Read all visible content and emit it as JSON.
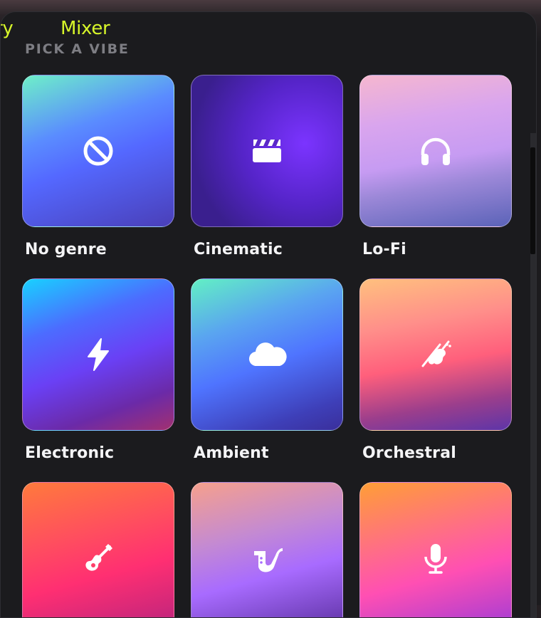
{
  "tabs": {
    "partial_label": "ry",
    "mixer_label": "Mixer"
  },
  "section": {
    "title": "PICK A VIBE"
  },
  "accent_color": "#d7f52a",
  "genres": [
    {
      "label": "No genre",
      "icon": "no-symbol-icon"
    },
    {
      "label": "Cinematic",
      "icon": "clapperboard-icon"
    },
    {
      "label": "Lo-Fi",
      "icon": "headphones-icon"
    },
    {
      "label": "Electronic",
      "icon": "lightning-bolt-icon"
    },
    {
      "label": "Ambient",
      "icon": "cloud-icon"
    },
    {
      "label": "Orchestral",
      "icon": "violin-icon"
    },
    {
      "label": "",
      "icon": "guitar-icon"
    },
    {
      "label": "",
      "icon": "saxophone-icon"
    },
    {
      "label": "",
      "icon": "microphone-icon"
    }
  ]
}
